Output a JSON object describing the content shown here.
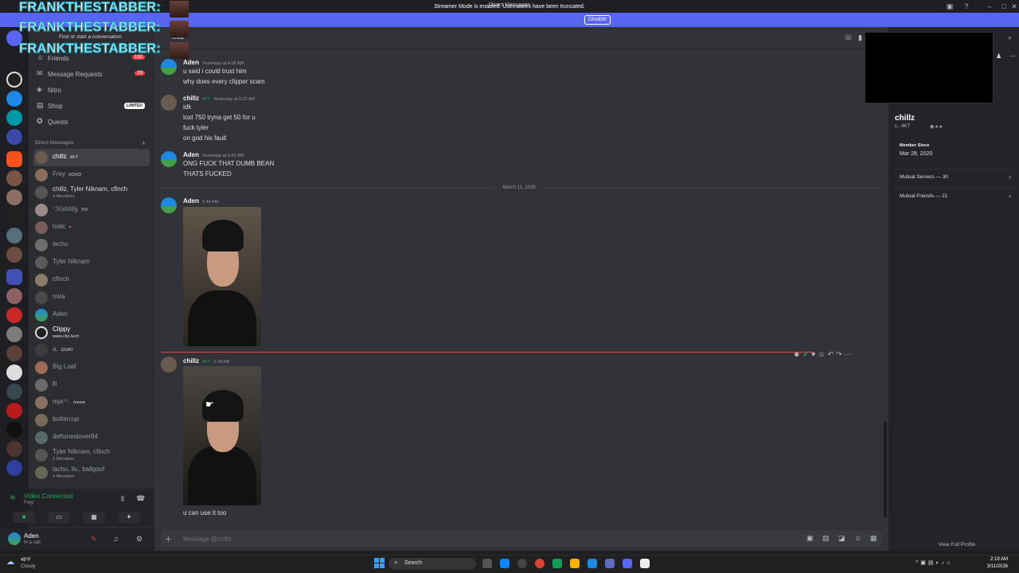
{
  "window": {
    "title": "Direct Messages"
  },
  "banner": {
    "text": "Streamer Mode is enabled. Usernames have been truncated.",
    "button": "Disable"
  },
  "overlay": {
    "lines": [
      "FRANKTHESTABBER:",
      "FRANKTHESTABBER:",
      "FRANKTHESTABBER:"
    ]
  },
  "search": {
    "placeholder": "Find or start a conversation"
  },
  "nav": {
    "friends": "Friends",
    "friends_count": "132",
    "requests": "Message Requests",
    "requests_count": "29",
    "nitro": "Nitro",
    "shop": "Shop",
    "shop_badge": "LIMITED",
    "quests": "Quests"
  },
  "dm_header": "Direct Messages",
  "dms": [
    {
      "name": "chillz",
      "tag": "4KT"
    },
    {
      "name": "Frey",
      "tag": "XOXO"
    },
    {
      "name": "chillz, Tyler Niknam, cfinch",
      "sub": "4 Members"
    },
    {
      "name": "ᐟℳєℓσ∂ყ",
      "tag": "ℬℬ"
    },
    {
      "name": "holic",
      "tag": "♥"
    },
    {
      "name": "lachu"
    },
    {
      "name": "Tyler Niknam"
    },
    {
      "name": "cfinch"
    },
    {
      "name": "mira"
    },
    {
      "name": "Aden"
    },
    {
      "name": "Clippy",
      "sub": "www.clip.tech"
    },
    {
      "name": "a.",
      "tag": "GOAT"
    },
    {
      "name": "Big Loaf"
    },
    {
      "name": "lll"
    },
    {
      "name": "mja⁺ᶜ.",
      "tag": "meow"
    },
    {
      "name": "buttercup"
    },
    {
      "name": "deftoneslover94"
    },
    {
      "name": "Tyler Niknam, cfinch",
      "sub": "3 Members"
    },
    {
      "name": "lachu, liv., ballgoof",
      "sub": "4 Members"
    }
  ],
  "voice": {
    "status": "Video Connected",
    "channel": "Frey"
  },
  "user": {
    "name": "Aden",
    "status": "In a call"
  },
  "chat": {
    "header_name": "chillz",
    "messages": [
      {
        "author": "Aden",
        "time": "Yesterday at 6:08 AM",
        "lines": [
          "u said i could trust him",
          "why does every clipper scam"
        ]
      },
      {
        "author": "chillz",
        "tag": "4KT",
        "time": "Yesterday at 6:22 AM",
        "lines": [
          "idk",
          "lost 750 tryna get 50 for u",
          "fuck tyler",
          "on god his fault"
        ]
      },
      {
        "author": "Aden",
        "time": "Yesterday at 6:22 AM",
        "lines": [
          "ONG FUCK THAT DUMB BEAN",
          "THATS FUCKED"
        ]
      },
      {
        "author": "Aden",
        "time": "1:49 AM",
        "lines": []
      },
      {
        "author": "chillz",
        "tag": "4KT",
        "time": "2:18 AM",
        "lines": [
          "u can use it too"
        ]
      }
    ],
    "date_divider": "March 11, 2026",
    "composer_placeholder": "Message @chillz"
  },
  "profile": {
    "name": "chillz",
    "sub": "c.. 4KT",
    "member_since_label": "Member Since",
    "member_since": "Mar 28, 2020",
    "mutual_servers": "Mutual Servers — 30",
    "mutual_friends": "Mutual Friends — 21",
    "view_full": "View Full Profile"
  },
  "taskbar": {
    "temp": "49°F",
    "weather": "Cloudy",
    "search": "Search",
    "time": "2:19 AM",
    "date": "3/11/2026"
  },
  "colors": {
    "blurple": "#5865f2",
    "online": "#23a55a",
    "danger": "#f23f43",
    "overlay_stroke": "#1aa7c2"
  }
}
